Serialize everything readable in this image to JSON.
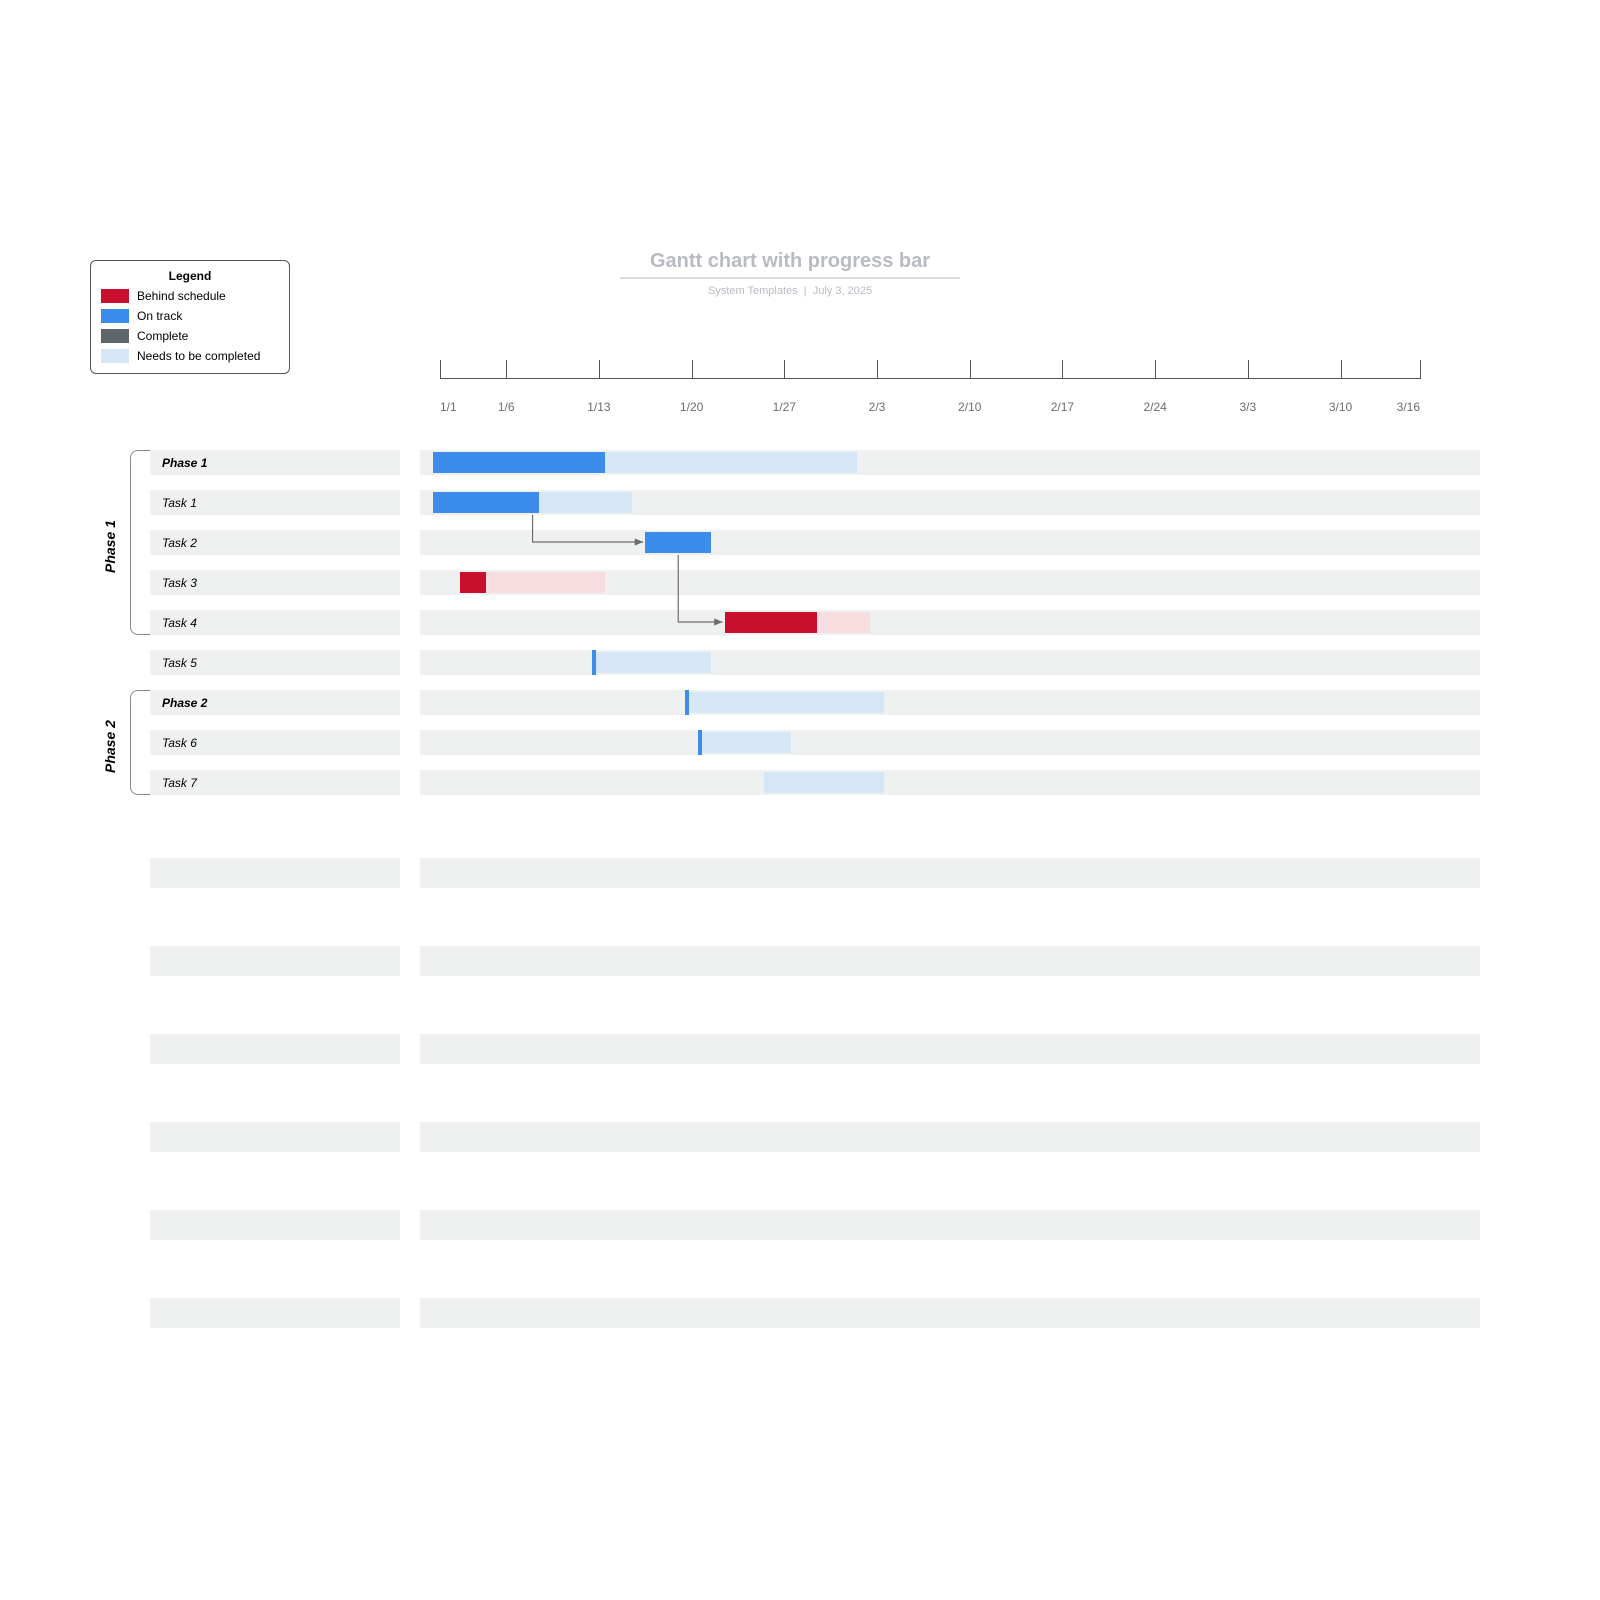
{
  "title": "Gantt chart with progress bar",
  "subtitle_left": "System Templates",
  "subtitle_right": "July 3, 2025",
  "legend": {
    "title": "Legend",
    "items": [
      {
        "label": "Behind schedule",
        "color": "#c8102e"
      },
      {
        "label": "On track",
        "color": "#3b8ceb"
      },
      {
        "label": "Complete",
        "color": "#5d646c"
      },
      {
        "label": "Needs to be completed",
        "color": "#d7e6f7"
      }
    ]
  },
  "phase_groups": [
    {
      "label": "Phase 1",
      "rows": [
        0,
        1,
        2,
        3,
        4
      ]
    },
    {
      "label": "Phase 2",
      "rows": [
        6,
        7,
        8
      ]
    }
  ],
  "timeline_dates": [
    "1/1",
    "1/6",
    "1/13",
    "1/20",
    "1/27",
    "2/3",
    "2/10",
    "2/17",
    "2/24",
    "3/3",
    "3/10",
    "3/16"
  ],
  "chart_data": {
    "type": "gantt",
    "x_axis": {
      "start": "1/1",
      "end": "3/16",
      "ticks": [
        "1/1",
        "1/6",
        "1/13",
        "1/20",
        "1/27",
        "2/3",
        "2/10",
        "2/17",
        "2/24",
        "3/3",
        "3/10",
        "3/16"
      ]
    },
    "status_colors": {
      "behind": {
        "progress": "#c8102e",
        "remaining": "#f7dde0"
      },
      "ontrack": {
        "progress": "#3b8ceb",
        "remaining": "#d7e6f7"
      },
      "complete": {
        "progress": "#5d646c",
        "remaining": "#d5d8dc"
      }
    },
    "tasks": [
      {
        "name": "Phase 1",
        "bold": true,
        "start": "1/2",
        "end": "2/3",
        "progress_end": "1/15",
        "status": "ontrack"
      },
      {
        "name": "Task 1",
        "start": "1/2",
        "end": "1/17",
        "progress_end": "1/10",
        "status": "ontrack"
      },
      {
        "name": "Task 2",
        "start": "1/18",
        "end": "1/23",
        "progress_end": "1/23",
        "status": "ontrack"
      },
      {
        "name": "Task 3",
        "start": "1/4",
        "end": "1/15",
        "progress_end": "1/6",
        "status": "behind"
      },
      {
        "name": "Task 4",
        "start": "1/24",
        "end": "2/4",
        "progress_end": "1/31",
        "status": "behind"
      },
      {
        "name": "Task 5",
        "start": "1/14",
        "end": "1/23",
        "progress_end": "1/14",
        "status": "ontrack",
        "tick_only": true
      },
      {
        "name": "Phase 2",
        "bold": true,
        "start": "1/21",
        "end": "2/5",
        "progress_end": "1/21",
        "status": "ontrack",
        "tick_only": true
      },
      {
        "name": "Task 6",
        "start": "1/22",
        "end": "1/29",
        "progress_end": "1/22",
        "status": "ontrack",
        "tick_only": true
      },
      {
        "name": "Task 7",
        "start": "1/27",
        "end": "2/5",
        "progress_end": "1/27",
        "status": "ontrack",
        "no_tick": true
      }
    ],
    "dependencies": [
      {
        "from": "Task 1",
        "to": "Task 2"
      },
      {
        "from": "Task 2",
        "to": "Task 4"
      }
    ],
    "empty_row_pairs_after": 6
  }
}
